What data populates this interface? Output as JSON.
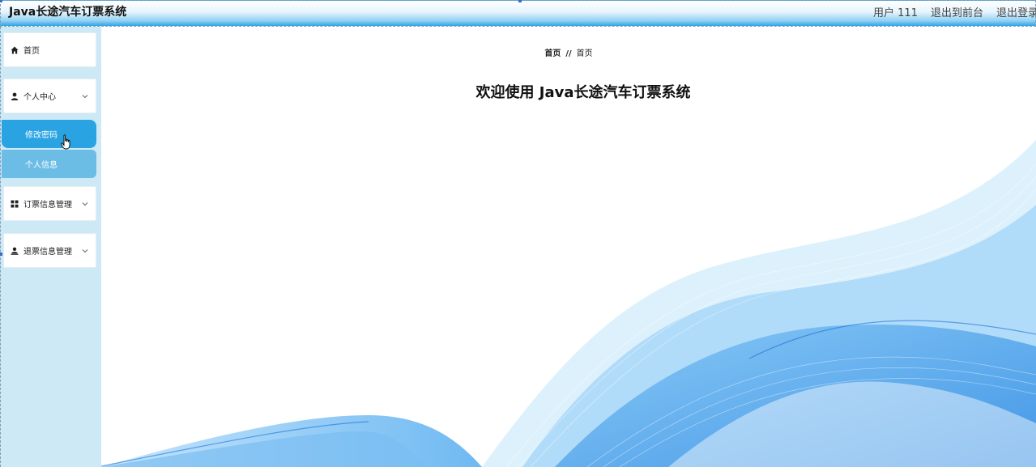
{
  "header": {
    "title": "Java长途汽车订票系统",
    "user_label": "用户 111",
    "to_front_label": "退出到前台",
    "logout_label": "退出登录"
  },
  "sidebar": {
    "items": [
      {
        "label": "首页",
        "icon": "home-icon",
        "expandable": false
      },
      {
        "label": "个人中心",
        "icon": "user-icon",
        "expandable": true,
        "expanded": true,
        "children": [
          {
            "label": "修改密码",
            "active": true
          },
          {
            "label": "个人信息",
            "active": false
          }
        ]
      },
      {
        "label": "订票信息管理",
        "icon": "grid-icon",
        "expandable": true
      },
      {
        "label": "退票信息管理",
        "icon": "user-account-icon",
        "expandable": true
      }
    ]
  },
  "main": {
    "breadcrumb": [
      "首页",
      "首页"
    ],
    "breadcrumb_separator": "//",
    "welcome_text": "欢迎使用 Java长途汽车订票系统"
  },
  "colors": {
    "accent": "#2aa3e2",
    "submenu": "#6cbde6",
    "sidebar_bg": "#cde9f5",
    "wave": "#1e8fe6"
  }
}
